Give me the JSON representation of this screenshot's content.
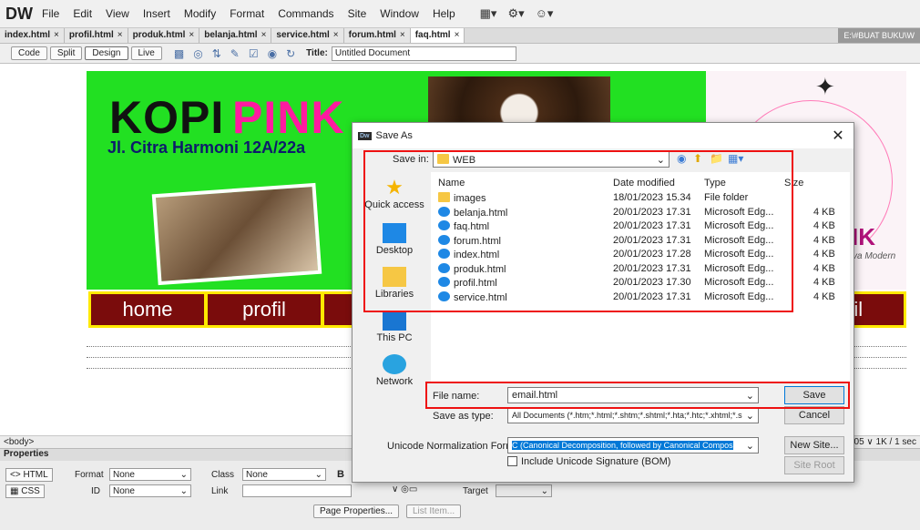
{
  "app": {
    "logo": "DW",
    "menu": [
      "File",
      "Edit",
      "View",
      "Insert",
      "Modify",
      "Format",
      "Commands",
      "Site",
      "Window",
      "Help"
    ]
  },
  "tabs": [
    {
      "label": "index.html"
    },
    {
      "label": "profil.html"
    },
    {
      "label": "produk.html"
    },
    {
      "label": "belanja.html"
    },
    {
      "label": "service.html"
    },
    {
      "label": "forum.html"
    },
    {
      "label": "faq.html"
    }
  ],
  "tab_path": "E:\\#BUAT BUKU\\W",
  "toolbar": {
    "view_buttons": [
      "Code",
      "Split",
      "Design",
      "Live"
    ],
    "title_label": "Title:",
    "title_value": "Untitled Document"
  },
  "page": {
    "brand_a": "KOPI",
    "brand_b": "PINK",
    "address": "Jl. Citra Harmoni 12A/22a",
    "brand_right": "IK",
    "tagline": "va Modern",
    "nav": [
      "home",
      "profil",
      "pro",
      "",
      "",
      "",
      "nail"
    ]
  },
  "status": {
    "tag": "<body>",
    "right": "05 ∨  1K / 1 sec"
  },
  "properties": {
    "header": "Properties",
    "tab_html": "<> HTML",
    "tab_css": "CSS",
    "format_label": "Format",
    "format_value": "None",
    "class_label": "Class",
    "class_value": "None",
    "id_label": "ID",
    "id_value": "None",
    "link_label": "Link",
    "target_label": "Target",
    "bold": "B",
    "page_props": "Page Properties...",
    "list_item": "List Item..."
  },
  "dialog": {
    "title": "Save As",
    "save_in_label": "Save in:",
    "save_in_value": "WEB",
    "places": [
      "Quick access",
      "Desktop",
      "Libraries",
      "This PC",
      "Network"
    ],
    "columns": [
      "Name",
      "Date modified",
      "Type",
      "Size"
    ],
    "files": [
      {
        "name": "images",
        "date": "18/01/2023 15.34",
        "type": "File folder",
        "size": "",
        "kind": "folder"
      },
      {
        "name": "belanja.html",
        "date": "20/01/2023 17.31",
        "type": "Microsoft Edg...",
        "size": "4 KB",
        "kind": "edge"
      },
      {
        "name": "faq.html",
        "date": "20/01/2023 17.31",
        "type": "Microsoft Edg...",
        "size": "4 KB",
        "kind": "edge"
      },
      {
        "name": "forum.html",
        "date": "20/01/2023 17.31",
        "type": "Microsoft Edg...",
        "size": "4 KB",
        "kind": "edge"
      },
      {
        "name": "index.html",
        "date": "20/01/2023 17.28",
        "type": "Microsoft Edg...",
        "size": "4 KB",
        "kind": "edge"
      },
      {
        "name": "produk.html",
        "date": "20/01/2023 17.31",
        "type": "Microsoft Edg...",
        "size": "4 KB",
        "kind": "edge"
      },
      {
        "name": "profil.html",
        "date": "20/01/2023 17.30",
        "type": "Microsoft Edg...",
        "size": "4 KB",
        "kind": "edge"
      },
      {
        "name": "service.html",
        "date": "20/01/2023 17.31",
        "type": "Microsoft Edg...",
        "size": "4 KB",
        "kind": "edge"
      }
    ],
    "file_name_label": "File name:",
    "file_name_value": "email.html",
    "save_type_label": "Save as type:",
    "save_type_value": "All Documents (*.htm;*.html;*.shtm;*.shtml;*.hta;*.htc;*.xhtml;*.s",
    "unicode_label": "Unicode Normalization Form:",
    "unicode_value": "C (Canonical Decomposition, followed by Canonical Compos",
    "bom_label": "Include Unicode Signature (BOM)",
    "save_btn": "Save",
    "cancel_btn": "Cancel",
    "new_site_btn": "New Site...",
    "site_root_btn": "Site Root"
  },
  "colors": {
    "banner_green": "#22e022",
    "brand_pink": "#ff1aa0",
    "nav_bg": "#7a0c0c",
    "nav_border": "#ffea00",
    "highlight_red": "#e11111",
    "select_blue": "#0078d7"
  }
}
